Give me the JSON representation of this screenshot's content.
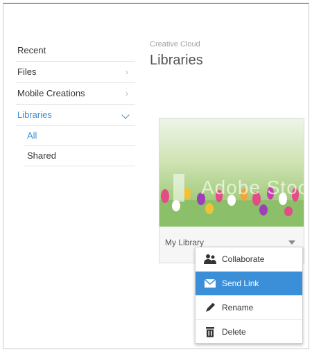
{
  "sidebar": {
    "items": [
      {
        "label": "Recent"
      },
      {
        "label": "Files",
        "chevron": "chevron-right-icon"
      },
      {
        "label": "Mobile Creations",
        "chevron": "chevron-right-icon"
      },
      {
        "label": "Libraries",
        "chevron": "chevron-down-icon"
      }
    ],
    "sub_items": [
      {
        "label": "All"
      },
      {
        "label": "Shared"
      }
    ]
  },
  "header": {
    "subtitle": "Creative Cloud",
    "title": "Libraries"
  },
  "library_card": {
    "name": "My Library",
    "watermark": "Adobe Stock"
  },
  "context_menu": {
    "items": [
      {
        "label": "Collaborate",
        "icon": "collaborate-icon"
      },
      {
        "label": "Send Link",
        "icon": "send-link-icon"
      },
      {
        "label": "Rename",
        "icon": "rename-icon"
      },
      {
        "label": "Delete",
        "icon": "delete-icon"
      }
    ]
  },
  "colors": {
    "accent": "#3b8fd8",
    "text": "#333333",
    "muted": "#9aa0a6"
  }
}
